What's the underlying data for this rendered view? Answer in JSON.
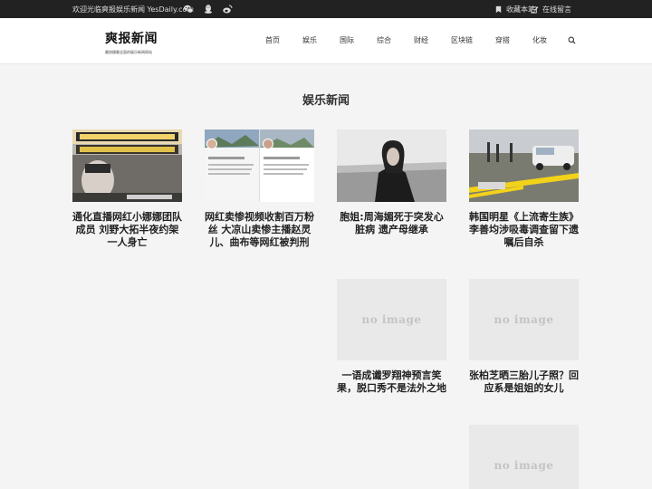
{
  "topbar": {
    "welcome": "欢迎光临爽报娱乐新闻 YesDaily.com",
    "icons": [
      "wechat-icon",
      "qq-icon",
      "weibo-icon"
    ],
    "bookmark_label": "收藏本站",
    "message_label": "在线留言"
  },
  "header": {
    "logo_title": "爽报新闻",
    "logo_subtitle": "最快捷最全面的娱乐新闻网站",
    "nav": [
      "首页",
      "娱乐",
      "国际",
      "综合",
      "财经",
      "区块链",
      "穿搭",
      "化妆"
    ]
  },
  "main": {
    "title": "娱乐新闻",
    "placeholder_text": "no image",
    "articles": [
      {
        "title": "通化直播网红小娜娜团队成员 刘野大拓半夜约架一人身亡",
        "has_image": true
      },
      {
        "title": "网红卖惨视频收割百万粉丝 大凉山卖惨主播赵灵儿、曲布等网红被判刑",
        "has_image": true
      },
      {
        "title": "胞姐:周海媚死于突发心脏病 遗产母继承",
        "has_image": true
      },
      {
        "title": "韩国明星《上流寄生族》李善均涉吸毒调查留下遗嘱后自杀",
        "has_image": true
      },
      {
        "title": "一语成谶罗翔神预言笑果，脱口秀不是法外之地",
        "has_image": false
      },
      {
        "title": "张柏芝晒三胎儿子照？回应系是姐姐的女儿",
        "has_image": false
      },
      {
        "title": "",
        "has_image": false
      }
    ]
  },
  "colors": {
    "topbar_bg": "#222222",
    "page_bg": "#f4f4f4",
    "header_bg": "#ffffff",
    "placeholder_bg": "#e9e9e9",
    "placeholder_text": "#c4c4c4"
  }
}
